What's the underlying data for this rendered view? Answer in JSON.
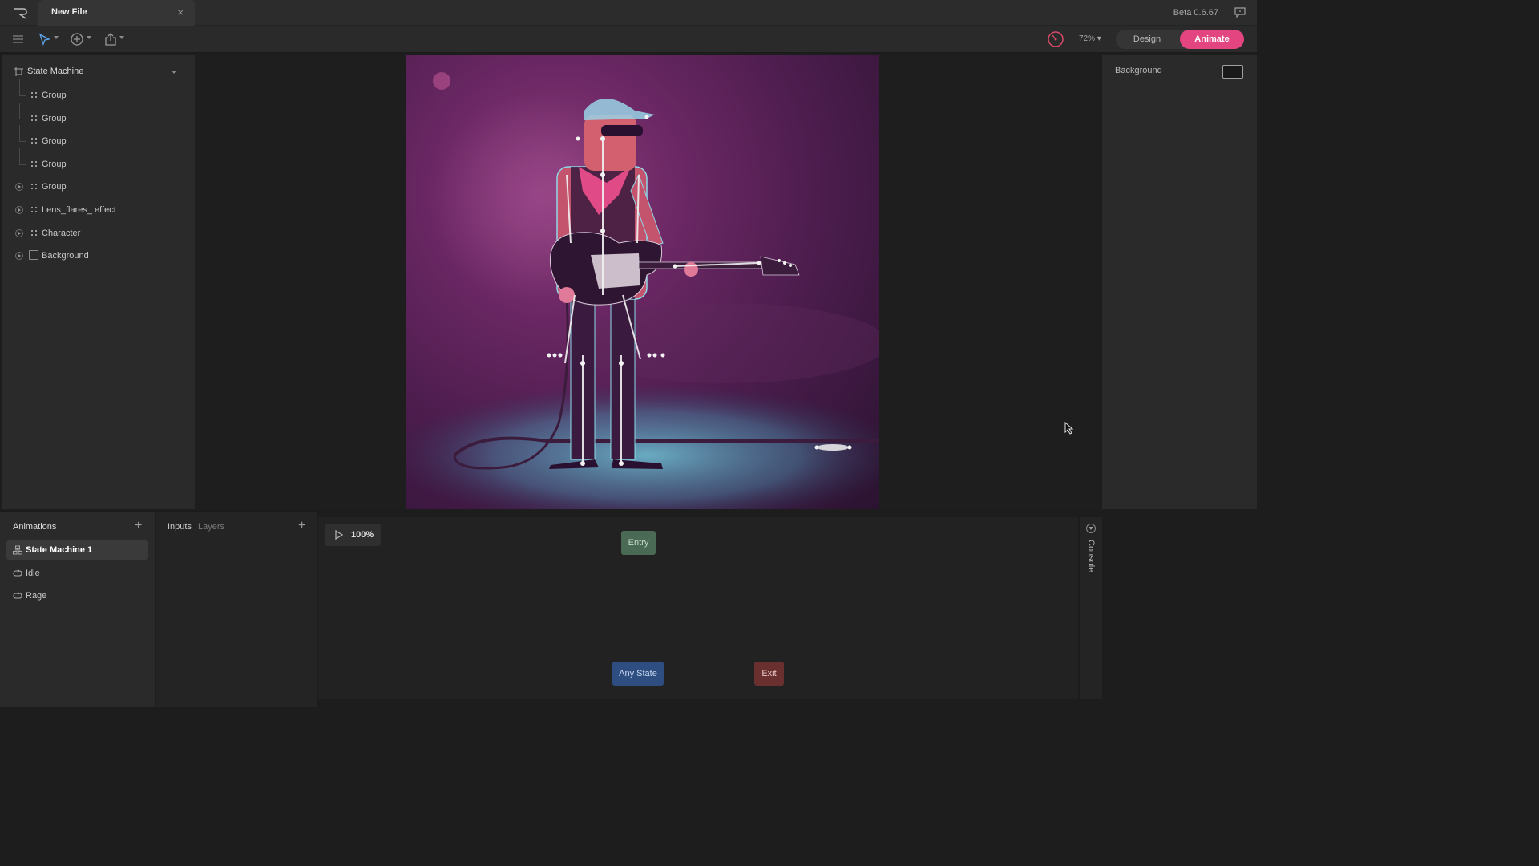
{
  "titlebar": {
    "tab_title": "New File",
    "close_glyph": "×",
    "version": "Beta 0.6.67",
    "icons": [
      "rive-logo-icon",
      "close-icon",
      "feedback-icon"
    ]
  },
  "toolbar": {
    "zoom": "72%",
    "mode_design": "Design",
    "mode_animate": "Animate",
    "active_mode": "Animate",
    "icons": [
      "menu-icon",
      "select-tool-icon",
      "add-tool-icon",
      "export-icon",
      "performance-icon"
    ]
  },
  "hierarchy": {
    "root": {
      "label": "State Machine",
      "icon": "artboard-icon"
    },
    "items": [
      {
        "label": "Group",
        "icon": "group-icon",
        "expandable": false
      },
      {
        "label": "Group",
        "icon": "group-icon",
        "expandable": false
      },
      {
        "label": "Group",
        "icon": "group-icon",
        "expandable": false
      },
      {
        "label": "Group",
        "icon": "group-icon",
        "expandable": false
      },
      {
        "label": "Group",
        "icon": "group-icon",
        "expandable": true
      },
      {
        "label": "Lens_flares_ effect",
        "icon": "group-icon",
        "expandable": true
      },
      {
        "label": "Character",
        "icon": "group-icon",
        "expandable": true
      },
      {
        "label": "Background",
        "icon": "shape-icon",
        "expandable": true
      }
    ]
  },
  "inspector": {
    "background_label": "Background"
  },
  "animations": {
    "header": "Animations",
    "add_glyph": "+",
    "items": [
      {
        "label": "State Machine 1",
        "icon": "state-machine-icon",
        "selected": true
      },
      {
        "label": "Idle",
        "icon": "loop-icon",
        "selected": false
      },
      {
        "label": "Rage",
        "icon": "loop-icon",
        "selected": false
      }
    ]
  },
  "inputs_panel": {
    "tab_inputs": "Inputs",
    "tab_layers": "Layers",
    "add_glyph": "+"
  },
  "graph": {
    "speed": "100%",
    "entry": "Entry",
    "any_state": "Any State",
    "exit": "Exit"
  },
  "console": {
    "label": "Console"
  },
  "colors": {
    "accent": "#e2457f",
    "entry_node": "#4b6a55",
    "any_state_node": "#2e4e82",
    "exit_node": "#6a3030"
  }
}
